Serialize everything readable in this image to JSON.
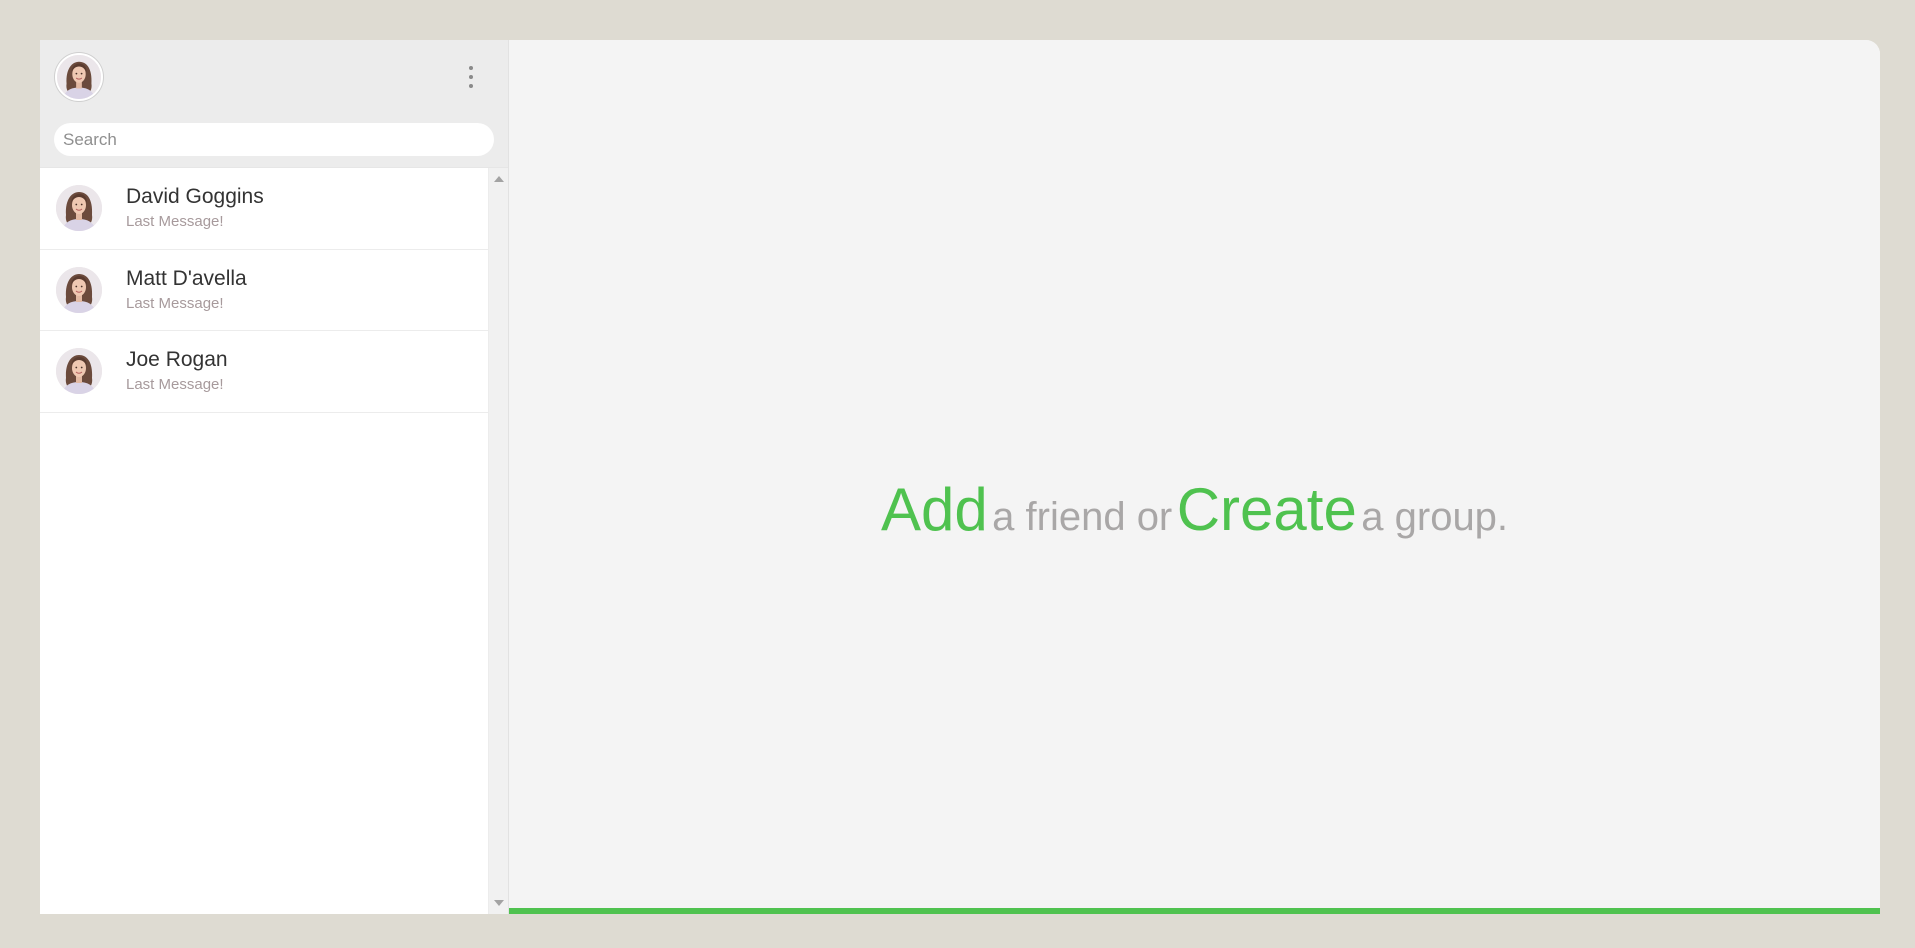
{
  "colors": {
    "background": "#dedbd2",
    "panel": "#f4f4f4",
    "sidebar_header": "#ececec",
    "accent_green": "#4fc24f",
    "muted_text": "#a9a7a7",
    "contact_name": "#333333",
    "last_message": "#a79a9c"
  },
  "sidebar": {
    "header": {
      "avatar_icon": "user-avatar",
      "menu_icon": "vertical-dots-icon"
    },
    "search": {
      "placeholder": "Search",
      "value": ""
    },
    "chats": [
      {
        "name": "David Goggins",
        "last_message": "Last Message!",
        "avatar_icon": "contact-avatar"
      },
      {
        "name": "Matt D'avella",
        "last_message": "Last Message!",
        "avatar_icon": "contact-avatar"
      },
      {
        "name": "Joe Rogan",
        "last_message": "Last Message!",
        "avatar_icon": "contact-avatar"
      }
    ]
  },
  "main": {
    "welcome": {
      "add_label": "Add",
      "text_middle": "a friend or",
      "create_label": "Create",
      "text_end": "a group."
    }
  }
}
